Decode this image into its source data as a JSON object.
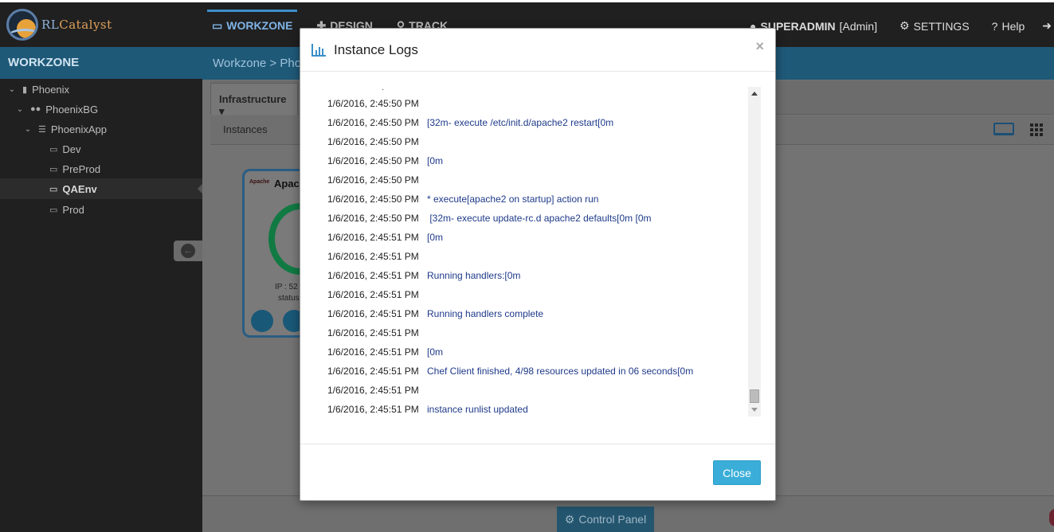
{
  "brand": {
    "prefix": "RL",
    "name": "Catalyst"
  },
  "topnav": {
    "items": [
      {
        "label": "WORKZONE",
        "icon": "credit-card-icon",
        "active": true
      },
      {
        "label": "DESIGN",
        "icon": "design-icon",
        "active": false
      },
      {
        "label": "TRACK",
        "icon": "track-icon",
        "active": false
      }
    ]
  },
  "usernav": {
    "user": "SUPERADMIN",
    "role": "[Admin]",
    "settings": "SETTINGS",
    "help": "Help"
  },
  "sidebar": {
    "title": "WORKZONE",
    "tree": [
      {
        "label": "Phoenix",
        "icon": "building-icon"
      },
      {
        "label": "PhoenixBG",
        "icon": "users-icon"
      },
      {
        "label": "PhoenixApp",
        "icon": "server-icon"
      },
      {
        "label": "Dev",
        "icon": "monitor-icon"
      },
      {
        "label": "PreProd",
        "icon": "monitor-icon"
      },
      {
        "label": "QAEnv",
        "icon": "monitor-icon",
        "selected": true
      },
      {
        "label": "Prod",
        "icon": "monitor-icon"
      }
    ]
  },
  "main": {
    "breadcrumb": "Workzone > Pho",
    "tab": "Infrastructure",
    "subtab": "Instances",
    "card": {
      "logo": "Apache",
      "title": "Apac",
      "ip": "IP : 52",
      "status": "status"
    },
    "control_panel": "Control Panel"
  },
  "modal": {
    "title": "Instance Logs",
    "close_x": "×",
    "close_button": "Close",
    "logs": [
      {
        "ts": "1/6/2016, 2:45:50 PM",
        "msg": ""
      },
      {
        "ts": "1/6/2016, 2:45:50 PM",
        "msg": "[32m- execute /etc/init.d/apache2 restart[0m"
      },
      {
        "ts": "1/6/2016, 2:45:50 PM",
        "msg": ""
      },
      {
        "ts": "1/6/2016, 2:45:50 PM",
        "msg": "[0m"
      },
      {
        "ts": "1/6/2016, 2:45:50 PM",
        "msg": ""
      },
      {
        "ts": "1/6/2016, 2:45:50 PM",
        "msg": "* execute[apache2 on startup] action run"
      },
      {
        "ts": "1/6/2016, 2:45:50 PM",
        "msg": " [32m- execute update-rc.d apache2 defaults[0m [0m"
      },
      {
        "ts": "1/6/2016, 2:45:51 PM",
        "msg": "[0m"
      },
      {
        "ts": "1/6/2016, 2:45:51 PM",
        "msg": ""
      },
      {
        "ts": "1/6/2016, 2:45:51 PM",
        "msg": "Running handlers:[0m"
      },
      {
        "ts": "1/6/2016, 2:45:51 PM",
        "msg": ""
      },
      {
        "ts": "1/6/2016, 2:45:51 PM",
        "msg": "Running handlers complete"
      },
      {
        "ts": "1/6/2016, 2:45:51 PM",
        "msg": ""
      },
      {
        "ts": "1/6/2016, 2:45:51 PM",
        "msg": "[0m"
      },
      {
        "ts": "1/6/2016, 2:45:51 PM",
        "msg": "Chef Client finished, 4/98 resources updated in 06 seconds[0m"
      },
      {
        "ts": "1/6/2016, 2:45:51 PM",
        "msg": ""
      },
      {
        "ts": "1/6/2016, 2:45:51 PM",
        "msg": "instance runlist updated"
      }
    ]
  },
  "colors": {
    "accent": "#3a8fc9",
    "header_blue": "#2b7da8",
    "close_button": "#3aaed8",
    "log_text": "#1e3a8a"
  }
}
